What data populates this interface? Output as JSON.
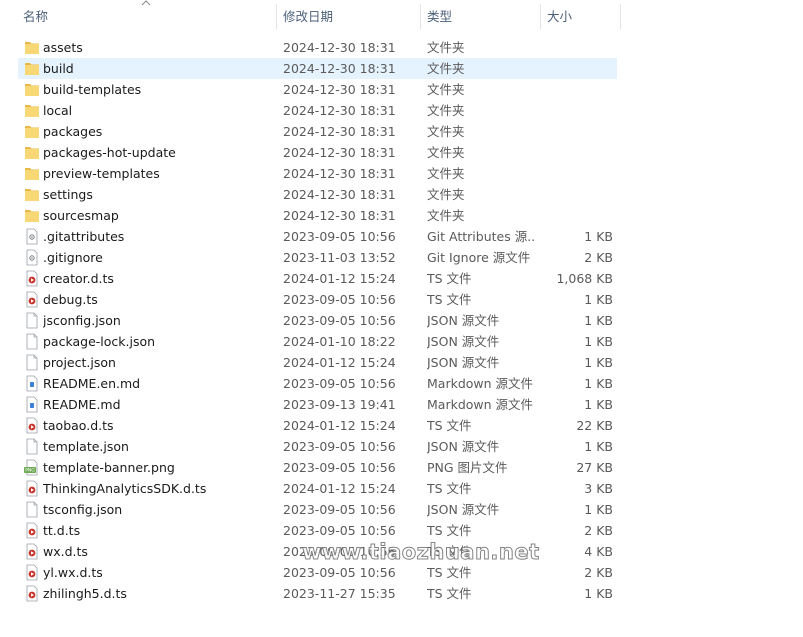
{
  "columns": {
    "name": "名称",
    "date": "修改日期",
    "type": "类型",
    "size": "大小"
  },
  "colors": {
    "header_text": "#4c607a",
    "selected_row": "#e5f3ff",
    "folder": "#f8d775"
  },
  "selected_index": 1,
  "files": [
    {
      "name": "assets",
      "date": "2024-12-30 18:31",
      "type": "文件夹",
      "size": "",
      "icon": "folder-icon"
    },
    {
      "name": "build",
      "date": "2024-12-30 18:31",
      "type": "文件夹",
      "size": "",
      "icon": "folder-icon"
    },
    {
      "name": "build-templates",
      "date": "2024-12-30 18:31",
      "type": "文件夹",
      "size": "",
      "icon": "folder-icon"
    },
    {
      "name": "local",
      "date": "2024-12-30 18:31",
      "type": "文件夹",
      "size": "",
      "icon": "folder-icon"
    },
    {
      "name": "packages",
      "date": "2024-12-30 18:31",
      "type": "文件夹",
      "size": "",
      "icon": "folder-icon"
    },
    {
      "name": "packages-hot-update",
      "date": "2024-12-30 18:31",
      "type": "文件夹",
      "size": "",
      "icon": "folder-icon"
    },
    {
      "name": "preview-templates",
      "date": "2024-12-30 18:31",
      "type": "文件夹",
      "size": "",
      "icon": "folder-icon"
    },
    {
      "name": "settings",
      "date": "2024-12-30 18:31",
      "type": "文件夹",
      "size": "",
      "icon": "folder-icon"
    },
    {
      "name": "sourcesmap",
      "date": "2024-12-30 18:31",
      "type": "文件夹",
      "size": "",
      "icon": "folder-icon"
    },
    {
      "name": ".gitattributes",
      "date": "2023-09-05 10:56",
      "type": "Git Attributes 源...",
      "size": "1 KB",
      "icon": "git-file-icon"
    },
    {
      "name": ".gitignore",
      "date": "2023-11-03 13:52",
      "type": "Git Ignore 源文件",
      "size": "2 KB",
      "icon": "git-file-icon"
    },
    {
      "name": "creator.d.ts",
      "date": "2024-01-12 15:24",
      "type": "TS 文件",
      "size": "1,068 KB",
      "icon": "ts-file-icon"
    },
    {
      "name": "debug.ts",
      "date": "2023-09-05 10:56",
      "type": "TS 文件",
      "size": "1 KB",
      "icon": "ts-file-icon"
    },
    {
      "name": "jsconfig.json",
      "date": "2023-09-05 10:56",
      "type": "JSON 源文件",
      "size": "1 KB",
      "icon": "json-file-icon"
    },
    {
      "name": "package-lock.json",
      "date": "2024-01-10 18:22",
      "type": "JSON 源文件",
      "size": "1 KB",
      "icon": "json-file-icon"
    },
    {
      "name": "project.json",
      "date": "2024-01-12 15:24",
      "type": "JSON 源文件",
      "size": "1 KB",
      "icon": "json-file-icon"
    },
    {
      "name": "README.en.md",
      "date": "2023-09-05 10:56",
      "type": "Markdown 源文件",
      "size": "1 KB",
      "icon": "markdown-file-icon"
    },
    {
      "name": "README.md",
      "date": "2023-09-13 19:41",
      "type": "Markdown 源文件",
      "size": "1 KB",
      "icon": "markdown-file-icon"
    },
    {
      "name": "taobao.d.ts",
      "date": "2024-01-12 15:24",
      "type": "TS 文件",
      "size": "22 KB",
      "icon": "ts-file-icon"
    },
    {
      "name": "template.json",
      "date": "2023-09-05 10:56",
      "type": "JSON 源文件",
      "size": "1 KB",
      "icon": "json-file-icon"
    },
    {
      "name": "template-banner.png",
      "date": "2023-09-05 10:56",
      "type": "PNG 图片文件",
      "size": "27 KB",
      "icon": "png-file-icon"
    },
    {
      "name": "ThinkingAnalyticsSDK.d.ts",
      "date": "2024-01-12 15:24",
      "type": "TS 文件",
      "size": "3 KB",
      "icon": "ts-file-icon"
    },
    {
      "name": "tsconfig.json",
      "date": "2023-09-05 10:56",
      "type": "JSON 源文件",
      "size": "1 KB",
      "icon": "json-file-icon"
    },
    {
      "name": "tt.d.ts",
      "date": "2023-09-05 10:56",
      "type": "TS 文件",
      "size": "2 KB",
      "icon": "ts-file-icon"
    },
    {
      "name": "wx.d.ts",
      "date": "2023-09-05 10:56",
      "type": "TS 文件",
      "size": "4 KB",
      "icon": "ts-file-icon"
    },
    {
      "name": "yl.wx.d.ts",
      "date": "2023-09-05 10:56",
      "type": "TS 文件",
      "size": "2 KB",
      "icon": "ts-file-icon"
    },
    {
      "name": "zhilingh5.d.ts",
      "date": "2023-11-27 15:35",
      "type": "TS 文件",
      "size": "1 KB",
      "icon": "ts-file-icon"
    }
  ],
  "watermark": "www.tiaozhuan.net"
}
